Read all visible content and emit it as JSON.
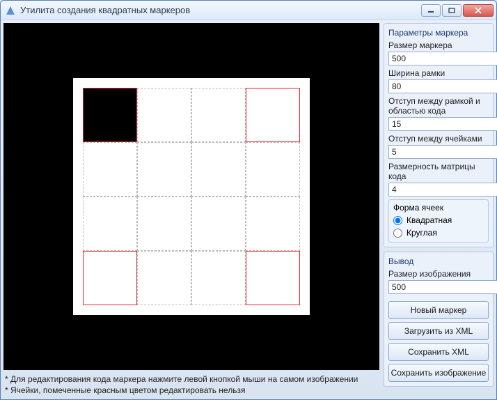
{
  "window": {
    "title": "Утилита создания квадратных маркеров"
  },
  "params": {
    "group_title": "Параметры маркера",
    "marker_size_label": "Размер маркера",
    "marker_size": "500",
    "frame_width_label": "Ширина рамки",
    "frame_width": "80",
    "frame_gap_label": "Отступ между рамкой и областью кода",
    "frame_gap": "15",
    "cell_gap_label": "Отступ между ячейками",
    "cell_gap": "5",
    "matrix_label": "Размерность матрицы кода",
    "matrix": "4",
    "shape_group": "Форма ячеек",
    "shape_square": "Квадратная",
    "shape_round": "Круглая"
  },
  "output": {
    "group_title": "Вывод",
    "image_size_label": "Размер изображения",
    "image_size": "500"
  },
  "buttons": {
    "new_marker": "Новый маркер",
    "load_xml": "Загрузить из XML",
    "save_xml": "Сохранить XML",
    "save_image": "Сохранить изображение"
  },
  "hints": {
    "h1": "* Для редактирования кода маркера нажмите левой кнопкой мыши на самом изображении",
    "h2": "* Ячейки, помеченные красным цветом редактировать нельзя"
  }
}
